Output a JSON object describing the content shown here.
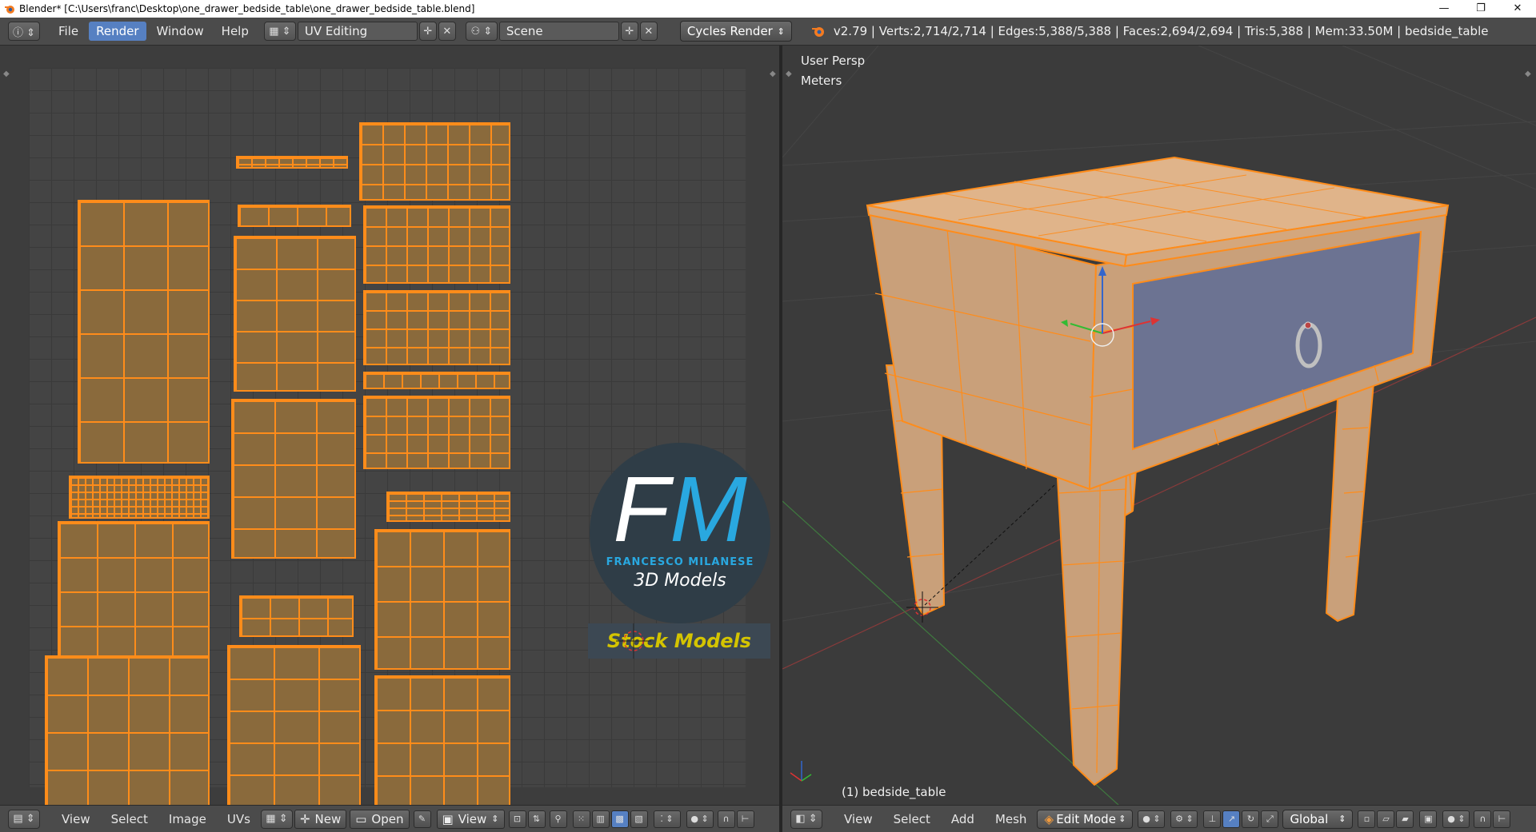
{
  "window": {
    "title": "Blender* [C:\\Users\\franc\\Desktop\\one_drawer_bedside_table\\one_drawer_bedside_table.blend]",
    "controls": [
      "—",
      "❐",
      "✕"
    ]
  },
  "infobar": {
    "menus": [
      "File",
      "Render",
      "Window",
      "Help"
    ],
    "active_menu": "Render",
    "screen_layout": "UV Editing",
    "scene": "Scene",
    "render_engine": "Cycles Render",
    "stats": "v2.79 | Verts:2,714/2,714 | Edges:5,388/5,388 | Faces:2,694/2,694 | Tris:5,388 | Mem:33.50M | bedside_table"
  },
  "uv_editor": {
    "menus": [
      "View",
      "Select",
      "Image",
      "UVs"
    ],
    "new_label": "New",
    "open_label": "Open",
    "view_label": "View"
  },
  "watermark": {
    "fm_f": "F",
    "fm_m": "M",
    "name": "FRANCESCO MILANESE",
    "sub": "3D Models",
    "banner": "Stock Models"
  },
  "viewport": {
    "view_name": "User Persp",
    "units": "Meters",
    "object_label": "(1) bedside_table",
    "menus": [
      "View",
      "Select",
      "Add",
      "Mesh"
    ],
    "mode": "Edit Mode",
    "orientation": "Global"
  },
  "colors": {
    "selection": "#ff8c1a",
    "active_tab": "#5680c2",
    "drawer_face": "#6c7392",
    "wood": "#c9a07a"
  }
}
